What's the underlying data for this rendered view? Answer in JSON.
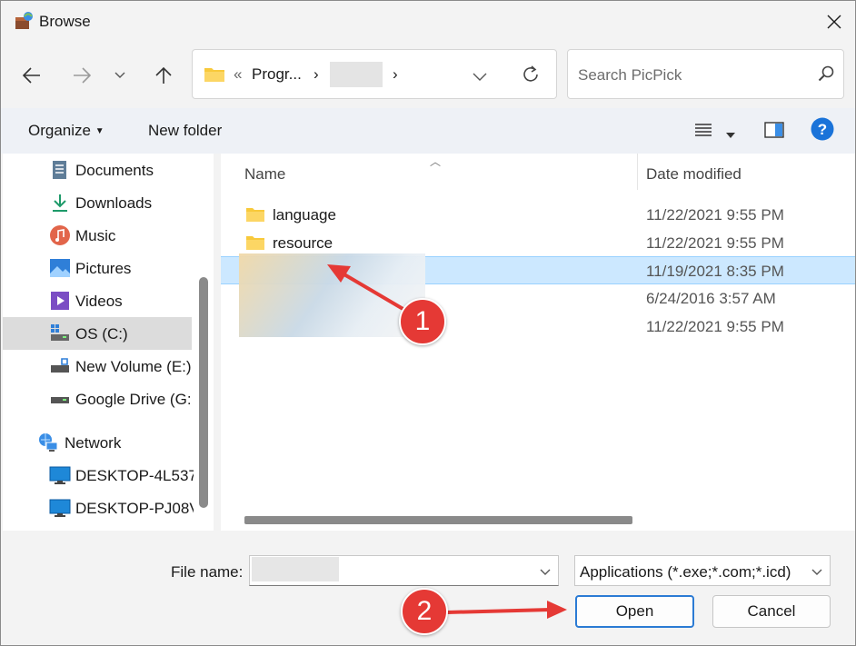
{
  "window": {
    "title": "Browse"
  },
  "address": {
    "separator": "«",
    "crumb_1": "Progr...",
    "crumb_arrow": "›"
  },
  "search": {
    "placeholder": "Search PicPick"
  },
  "toolbar": {
    "organize_label": "Organize",
    "new_folder_label": "New folder"
  },
  "sidebar": {
    "items": [
      {
        "label": "Documents",
        "icon": "documents-icon"
      },
      {
        "label": "Downloads",
        "icon": "downloads-icon"
      },
      {
        "label": "Music",
        "icon": "music-icon"
      },
      {
        "label": "Pictures",
        "icon": "pictures-icon"
      },
      {
        "label": "Videos",
        "icon": "videos-icon"
      },
      {
        "label": "OS (C:)",
        "icon": "drive-c-icon",
        "selected": true
      },
      {
        "label": "New Volume (E:)",
        "icon": "usb-drive-icon"
      },
      {
        "label": "Google Drive (G:",
        "icon": "drive-icon"
      },
      {
        "label": "Network",
        "icon": "network-icon"
      },
      {
        "label": "DESKTOP-4L537",
        "icon": "computer-icon"
      },
      {
        "label": "DESKTOP-PJ08V",
        "icon": "computer-icon"
      }
    ]
  },
  "filelist": {
    "columns": {
      "name": "Name",
      "date": "Date modified"
    },
    "rows": [
      {
        "name": "language",
        "date": "11/22/2021 9:55 PM",
        "icon": "folder-icon",
        "selected": false
      },
      {
        "name": "resource",
        "date": "11/22/2021 9:55 PM",
        "icon": "folder-icon",
        "selected": false
      },
      {
        "name": "",
        "date": "11/19/2021 8:35 PM",
        "icon": "",
        "selected": true
      },
      {
        "name": "",
        "date": "6/24/2016 3:57 AM",
        "icon": "",
        "selected": false
      },
      {
        "name": "",
        "date": "11/22/2021 9:55 PM",
        "icon": "",
        "selected": false
      }
    ]
  },
  "footer": {
    "file_name_label": "File name:",
    "file_name_value": "",
    "file_type": "Applications (*.exe;*.com;*.icd)",
    "open_label": "Open",
    "cancel_label": "Cancel"
  },
  "annotations": {
    "step_1": "1",
    "step_2": "2"
  },
  "colors": {
    "accent": "#2b7bd4",
    "selection": "#cce8ff",
    "annotation": "#e53935",
    "help": "#1a73d9"
  }
}
